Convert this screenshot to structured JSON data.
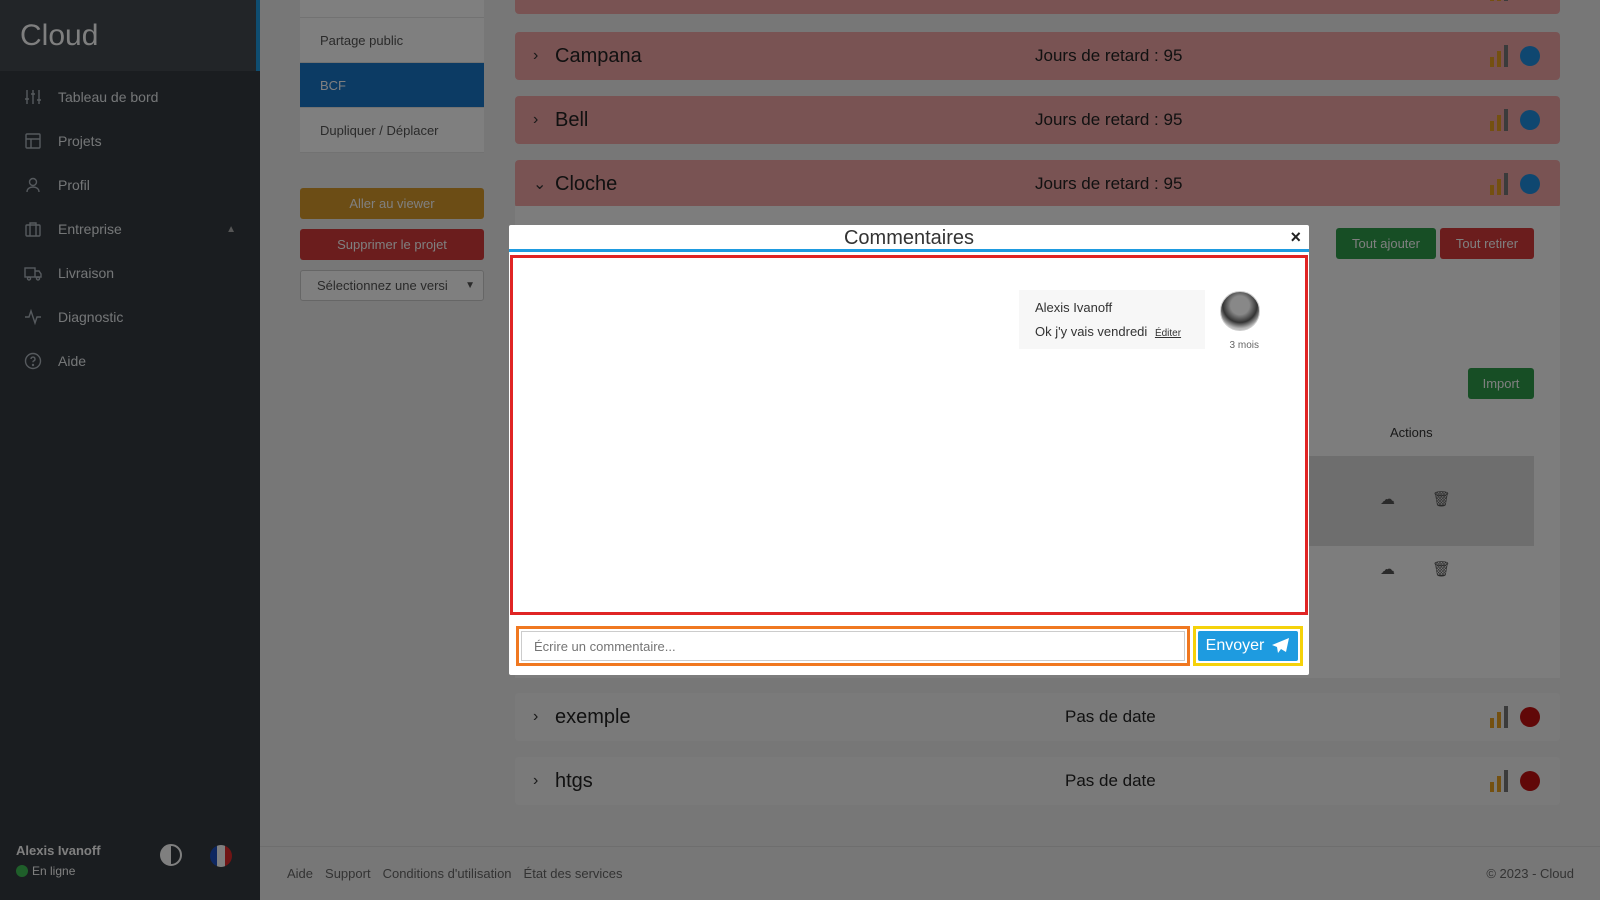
{
  "sidebar": {
    "brand": "Cloud",
    "items": [
      {
        "label": "Tableau de bord",
        "icon": "sliders-icon"
      },
      {
        "label": "Projets",
        "icon": "layout-icon"
      },
      {
        "label": "Profil",
        "icon": "user-icon"
      },
      {
        "label": "Entreprise",
        "icon": "briefcase-icon"
      },
      {
        "label": "Livraison",
        "icon": "truck-icon"
      },
      {
        "label": "Diagnostic",
        "icon": "activity-icon"
      },
      {
        "label": "Aide",
        "icon": "help-circle-icon"
      }
    ],
    "user": {
      "name": "Alexis Ivanoff",
      "status": "En ligne"
    }
  },
  "subnav": {
    "items": [
      "Partage public",
      "BCF",
      "Dupliquer / Déplacer"
    ],
    "active": "BCF"
  },
  "actions": {
    "viewer": "Aller au viewer",
    "delete": "Supprimer le projet",
    "version_placeholder": "Sélectionnez une versi"
  },
  "issues": [
    {
      "title": "Campana",
      "status": "Jours de retard : 95"
    },
    {
      "title": "Bell",
      "status": "Jours de retard : 95"
    },
    {
      "title": "Cloche",
      "status": "Jours de retard : 95"
    },
    {
      "title": "exemple",
      "status": "Pas de date"
    },
    {
      "title": "htgs",
      "status": "Pas de date"
    }
  ],
  "detail": {
    "add_all": "Tout ajouter",
    "remove_all": "Tout retirer",
    "import": "Import",
    "actions_header": "Actions"
  },
  "modal": {
    "title": "Commentaires",
    "close": "×",
    "comment": {
      "author": "Alexis Ivanoff",
      "text": "Ok j'y vais vendredi",
      "edit": "Éditer",
      "time": "3 mois"
    },
    "input_placeholder": "Écrire un commentaire...",
    "send": "Envoyer"
  },
  "footer": {
    "links": [
      "Aide",
      "Support",
      "Conditions d'utilisation",
      "État des services"
    ],
    "copyright": "© 2023 - Cloud"
  },
  "colors": {
    "accent": "#1e9be0",
    "overdue_row": "#f2a7a7",
    "status_blue": "#1e8ee0",
    "status_red": "#c21010"
  }
}
